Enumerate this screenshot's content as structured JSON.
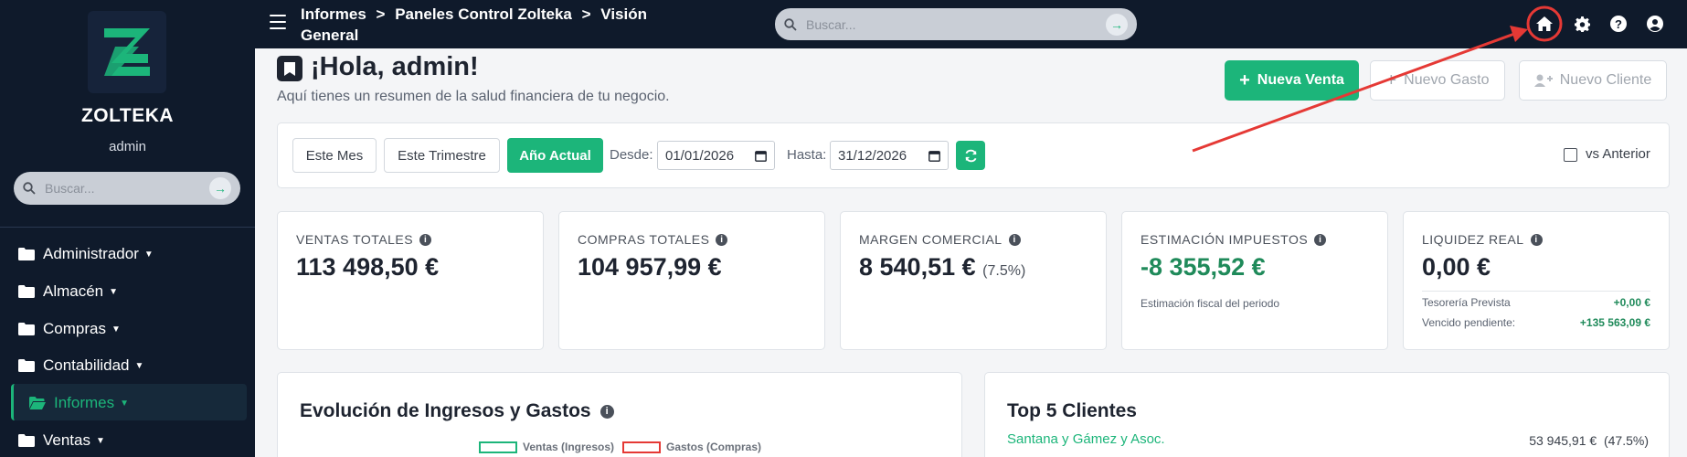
{
  "sidebar": {
    "brand": "ZOLTEKA",
    "user": "admin",
    "search_placeholder": "Buscar...",
    "items": [
      {
        "label": "Administrador"
      },
      {
        "label": "Almacén"
      },
      {
        "label": "Compras"
      },
      {
        "label": "Contabilidad"
      },
      {
        "label": "Informes",
        "active": true
      },
      {
        "label": "Ventas"
      }
    ]
  },
  "topbar": {
    "crumb1": "Informes",
    "crumb2": "Paneles Control Zolteka",
    "crumb3": "Visión General",
    "search_placeholder": "Buscar...",
    "icons": [
      "home-icon",
      "gear-icon",
      "help-icon",
      "user-icon"
    ]
  },
  "header": {
    "title": "¡Hola, admin!",
    "subtitle": "Aquí tienes un resumen de la salud financiera de tu negocio.",
    "btn_new_sale": "Nueva Venta",
    "btn_new_expense": "Nuevo Gasto",
    "btn_new_client": "Nuevo Cliente"
  },
  "filters": {
    "this_month": "Este Mes",
    "this_quarter": "Este Trimestre",
    "current_year": "Año Actual",
    "from_label": "Desde:",
    "from_value": "01/01/2026",
    "to_label": "Hasta:",
    "to_value": "31/12/2026",
    "compare_label": "vs Anterior"
  },
  "kpis": {
    "sales": {
      "label": "VENTAS TOTALES",
      "value": "113 498,50 €"
    },
    "purchases": {
      "label": "COMPRAS TOTALES",
      "value": "104 957,99 €"
    },
    "margin": {
      "label": "MARGEN COMERCIAL",
      "value": "8 540,51 €",
      "pct": "(7.5%)"
    },
    "taxes": {
      "label": "ESTIMACIÓN IMPUESTOS",
      "value": "-8 355,52 €",
      "note": "Estimación fiscal del periodo"
    },
    "liquidity": {
      "label": "LIQUIDEZ REAL",
      "value": "0,00 €",
      "row1_label": "Tesorería Prevista",
      "row1_value": "+0,00 €",
      "row2_label": "Vencido pendiente:",
      "row2_value": "+135 563,09 €"
    }
  },
  "chart_section": {
    "title": "Evolución de Ingresos y Gastos",
    "legend_sales": "Ventas (Ingresos)",
    "legend_expenses": "Gastos (Compras)"
  },
  "clients_section": {
    "title": "Top 5 Clientes",
    "rows": [
      {
        "name": "Santana y Gámez y Asoc.",
        "value": "53 945,91 €",
        "pct": "(47.5%)"
      }
    ]
  },
  "colors": {
    "accent": "#1cb57a",
    "dark": "#0f1a2b",
    "annotation": "#e53935",
    "expenses": "#e53935"
  }
}
